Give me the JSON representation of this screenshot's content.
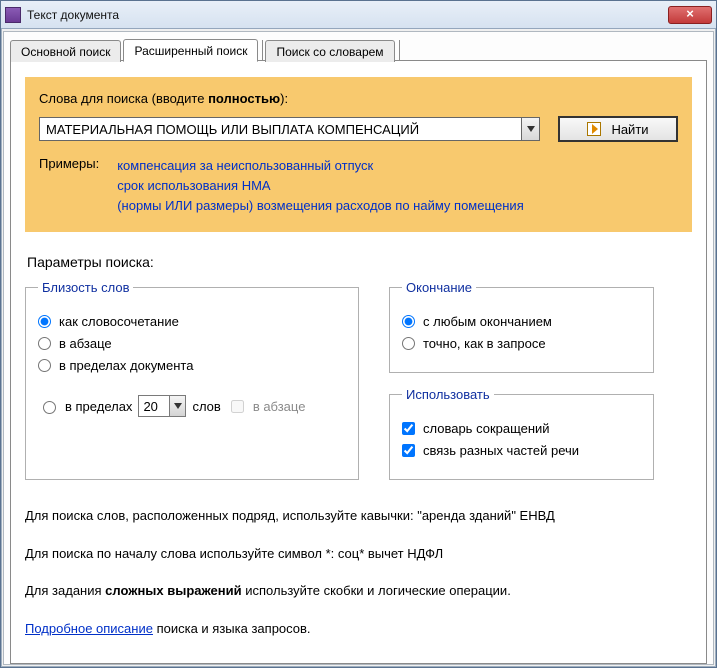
{
  "window": {
    "title": "Текст документа",
    "close_glyph": "×"
  },
  "tabs": {
    "main": "Основной поиск",
    "advanced": "Расширенный поиск",
    "dict": "Поиск со словарем"
  },
  "search": {
    "label_prefix": "Слова для поиска (вводите ",
    "label_bold": "полностью",
    "label_suffix": "):",
    "value": "МАТЕРИАЛЬНАЯ ПОМОЩЬ ИЛИ ВЫПЛАТА КОМПЕНСАЦИЙ",
    "find_label": "Найти"
  },
  "examples": {
    "caption": "Примеры:",
    "line1": "компенсация за неиспользованный отпуск",
    "line2": "срок использования НМА",
    "line3": "(нормы ИЛИ размеры) возмещения расходов по найму помещения"
  },
  "params_title": "Параметры поиска:",
  "proximity": {
    "legend": "Близость слов",
    "as_phrase": "как словосочетание",
    "in_paragraph": "в абзаце",
    "in_document": "в пределах документа",
    "within_prefix": "в пределах",
    "within_value": "20",
    "within_words": "слов",
    "within_para_cb": "в абзаце"
  },
  "ending": {
    "legend": "Окончание",
    "any": "с любым окончанием",
    "exact": "точно, как в запросе"
  },
  "use": {
    "legend": "Использовать",
    "abbr_dict": "словарь сокращений",
    "pos_link": "связь разных частей речи"
  },
  "hints": {
    "quotes": "Для поиска слов, расположенных подряд, используйте кавычки: \"аренда зданий\" ЕНВД",
    "star": "Для поиска по началу слова используйте символ *: соц* вычет НДФЛ",
    "expr_prefix": "Для задания ",
    "expr_bold": "сложных выражений",
    "expr_suffix": " используйте скобки и логические операции.",
    "link": "Подробное описание",
    "link_suffix": " поиска и языка запросов."
  }
}
